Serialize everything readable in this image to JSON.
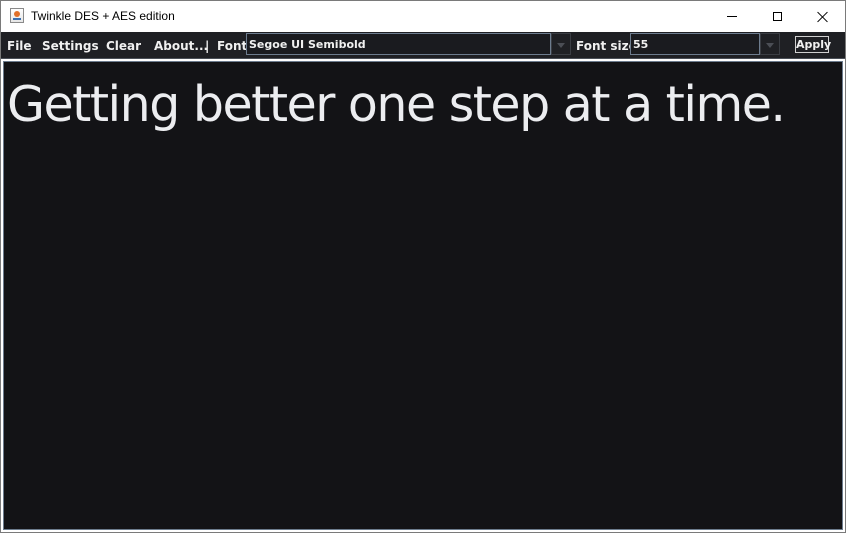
{
  "window": {
    "title": "Twinkle DES + AES edition",
    "icon": "java-cup-icon"
  },
  "titlebar_controls": {
    "minimize": "minimize-icon",
    "maximize": "maximize-icon",
    "close": "close-icon"
  },
  "menubar": {
    "file": "File",
    "settings": "Settings",
    "clear": "Clear",
    "about": "About...",
    "separator": "|",
    "font_label": "Font",
    "font_value": "Segoe UI Semibold",
    "font_size_label": "Font size",
    "font_size_value": "55",
    "apply": "Apply"
  },
  "editor": {
    "text": "Getting better one step at a time."
  },
  "colors": {
    "toolbar_bg": "#1f2024",
    "editor_bg": "#131316",
    "text": "#ecedf0",
    "border_accent": "#6d7c8e"
  }
}
